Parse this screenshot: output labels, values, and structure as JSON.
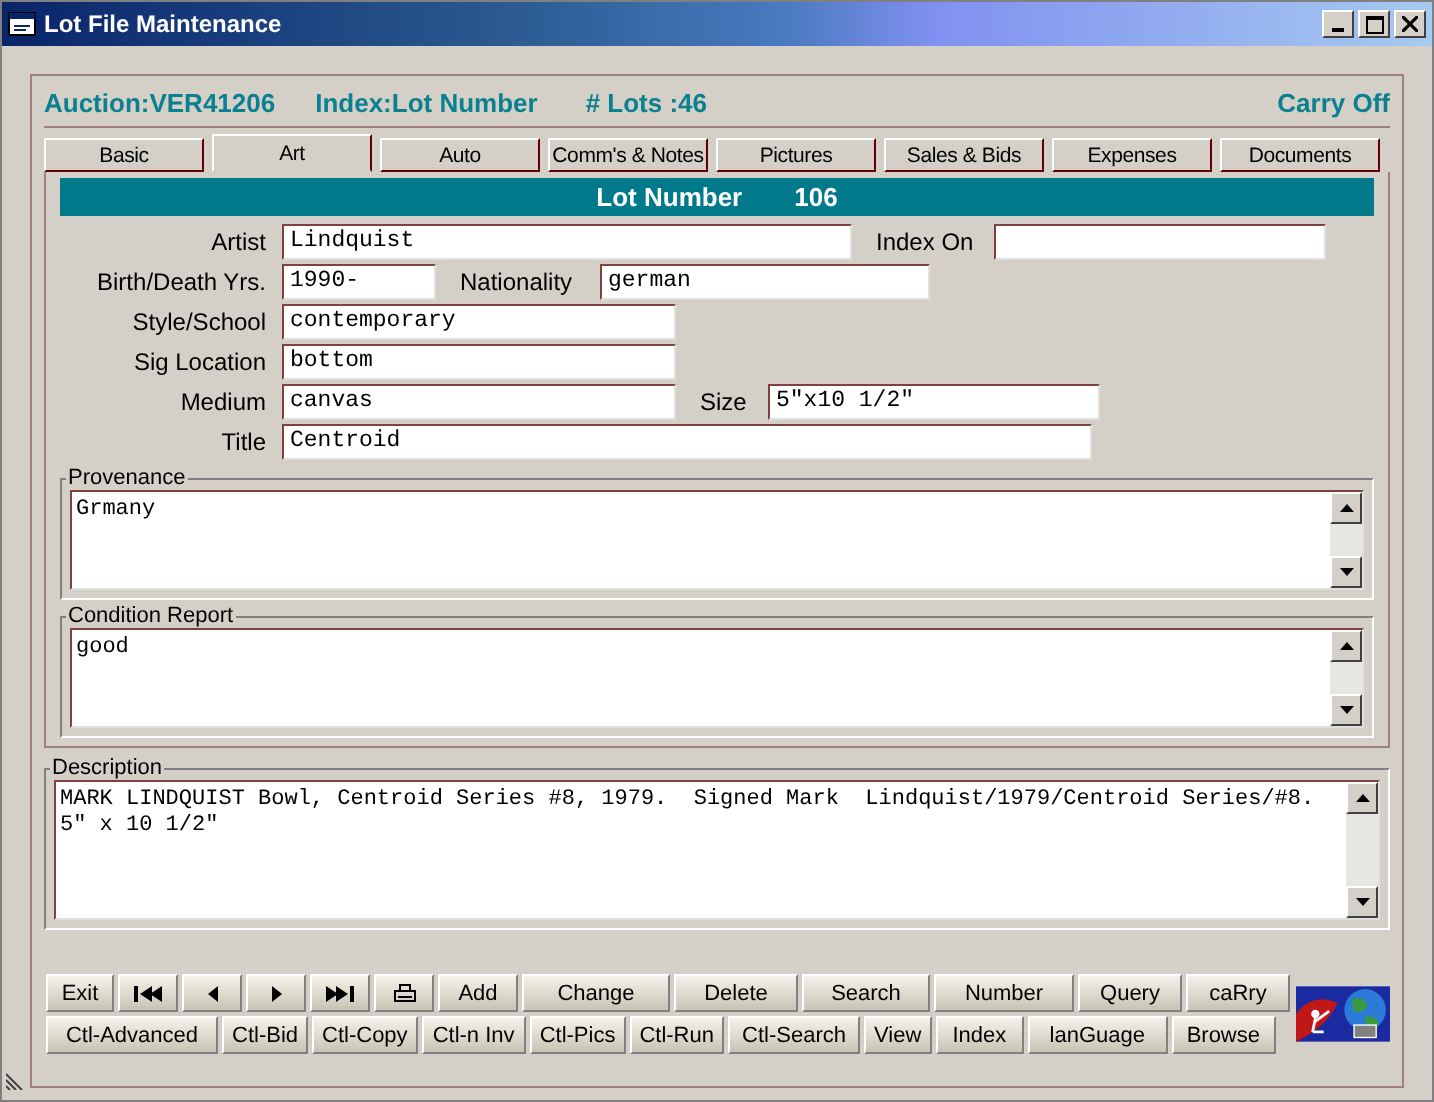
{
  "window": {
    "title": "Lot File Maintenance"
  },
  "header": {
    "auction": "Auction:VER41206",
    "index": "Index:Lot Number",
    "lots": "# Lots :46",
    "carry": "Carry Off"
  },
  "tabs": [
    {
      "label": "Basic",
      "selected": false
    },
    {
      "label": "Art",
      "selected": true
    },
    {
      "label": "Auto",
      "selected": false
    },
    {
      "label": "Comm's & Notes",
      "selected": false
    },
    {
      "label": "Pictures",
      "selected": false
    },
    {
      "label": "Sales & Bids",
      "selected": false
    },
    {
      "label": "Expenses",
      "selected": false
    },
    {
      "label": "Documents",
      "selected": false
    }
  ],
  "lot_bar": {
    "label": "Lot Number",
    "value": "106"
  },
  "form_rows": [
    {
      "fields": [
        {
          "label": "Artist",
          "value": "Lindquist"
        },
        {
          "label": "Index On"
        }
      ]
    },
    {
      "fields": [
        {
          "label": "Birth/Death Yrs.",
          "value": "1990-"
        },
        {
          "label": "Nationality",
          "value": "german"
        }
      ]
    },
    {
      "fields": [
        {
          "label": "Style/School",
          "value": "contemporary"
        }
      ]
    },
    {
      "fields": [
        {
          "label": "Sig Location",
          "value": "bottom"
        }
      ]
    },
    {
      "fields": [
        {
          "label": "Medium",
          "value": "canvas"
        },
        {
          "label": "Size",
          "value": "5\"x10 1/2\""
        }
      ]
    },
    {
      "fields": [
        {
          "label": "Title",
          "value": "Centroid"
        }
      ]
    }
  ],
  "provenance": {
    "label": "Provenance",
    "value": "Grmany"
  },
  "condition_report": {
    "label": "Condition Report",
    "value": "good"
  },
  "description": {
    "label": "Description",
    "value": "MARK LINDQUIST Bowl, Centroid Series #8, 1979.  Signed Mark  Lindquist/1979/Centroid Series/#8.  5\" x 10 1/2\""
  },
  "button_rows": [
    [
      {
        "kind": "text",
        "label": "Exit"
      },
      {
        "kind": "first"
      },
      {
        "kind": "prev"
      },
      {
        "kind": "next"
      },
      {
        "kind": "last"
      },
      {
        "kind": "print"
      },
      {
        "kind": "text",
        "label": "Add"
      },
      {
        "kind": "text",
        "label": "Change"
      },
      {
        "kind": "text",
        "label": "Delete"
      },
      {
        "kind": "text",
        "label": "Search"
      },
      {
        "kind": "text",
        "label": "Number"
      },
      {
        "kind": "text",
        "label": "Query"
      },
      {
        "kind": "text",
        "label": "caRry"
      }
    ],
    [
      {
        "kind": "text",
        "label": "Ctl-Advanced"
      },
      {
        "kind": "text",
        "label": "Ctl-Bid"
      },
      {
        "kind": "text",
        "label": "Ctl-Copy"
      },
      {
        "kind": "text",
        "label": "Ctl-n Inv"
      },
      {
        "kind": "text",
        "label": "Ctl-Pics"
      },
      {
        "kind": "text",
        "label": "Ctl-Run"
      },
      {
        "kind": "text",
        "label": "Ctl-Search"
      },
      {
        "kind": "text",
        "label": "View"
      },
      {
        "kind": "text",
        "label": "Index"
      },
      {
        "kind": "text",
        "label": "lanGuage"
      },
      {
        "kind": "text",
        "label": "Browse"
      }
    ]
  ]
}
